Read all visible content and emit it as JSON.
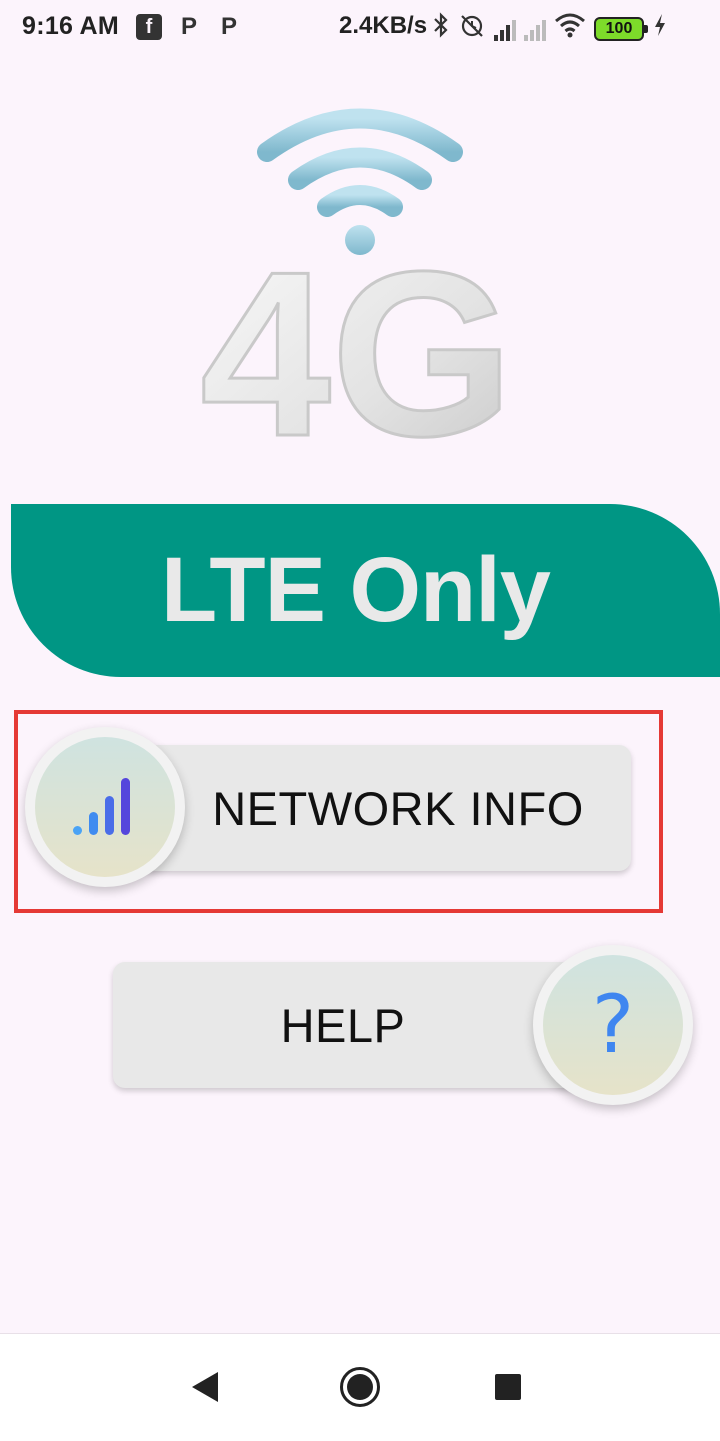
{
  "status_bar": {
    "time": "9:16 AM",
    "app_icons": [
      "facebook-icon",
      "pinterest-icon",
      "pinterest-icon"
    ],
    "app_icon_glyphs": [
      "f",
      "P",
      "P"
    ],
    "network_speed": "2.4KB/s",
    "battery_level": "100",
    "icons": [
      "bluetooth-icon",
      "alarm-off-icon",
      "signal-icon",
      "signal-no-service-icon",
      "wifi-icon",
      "battery-icon",
      "charging-icon"
    ]
  },
  "hero": {
    "label": "4G",
    "icon": "wifi-4g-logo"
  },
  "banner": {
    "title": "LTE Only",
    "color": "#009684"
  },
  "buttons": {
    "network_info": {
      "label": "NETWORK INFO",
      "icon": "signal-bars-icon"
    },
    "help": {
      "label": "HELP",
      "icon": "question-mark-icon",
      "glyph": "?"
    }
  },
  "highlight_color": "#e53935",
  "nav_bar": {
    "icons": [
      "back-icon",
      "home-icon",
      "recent-apps-icon"
    ]
  }
}
